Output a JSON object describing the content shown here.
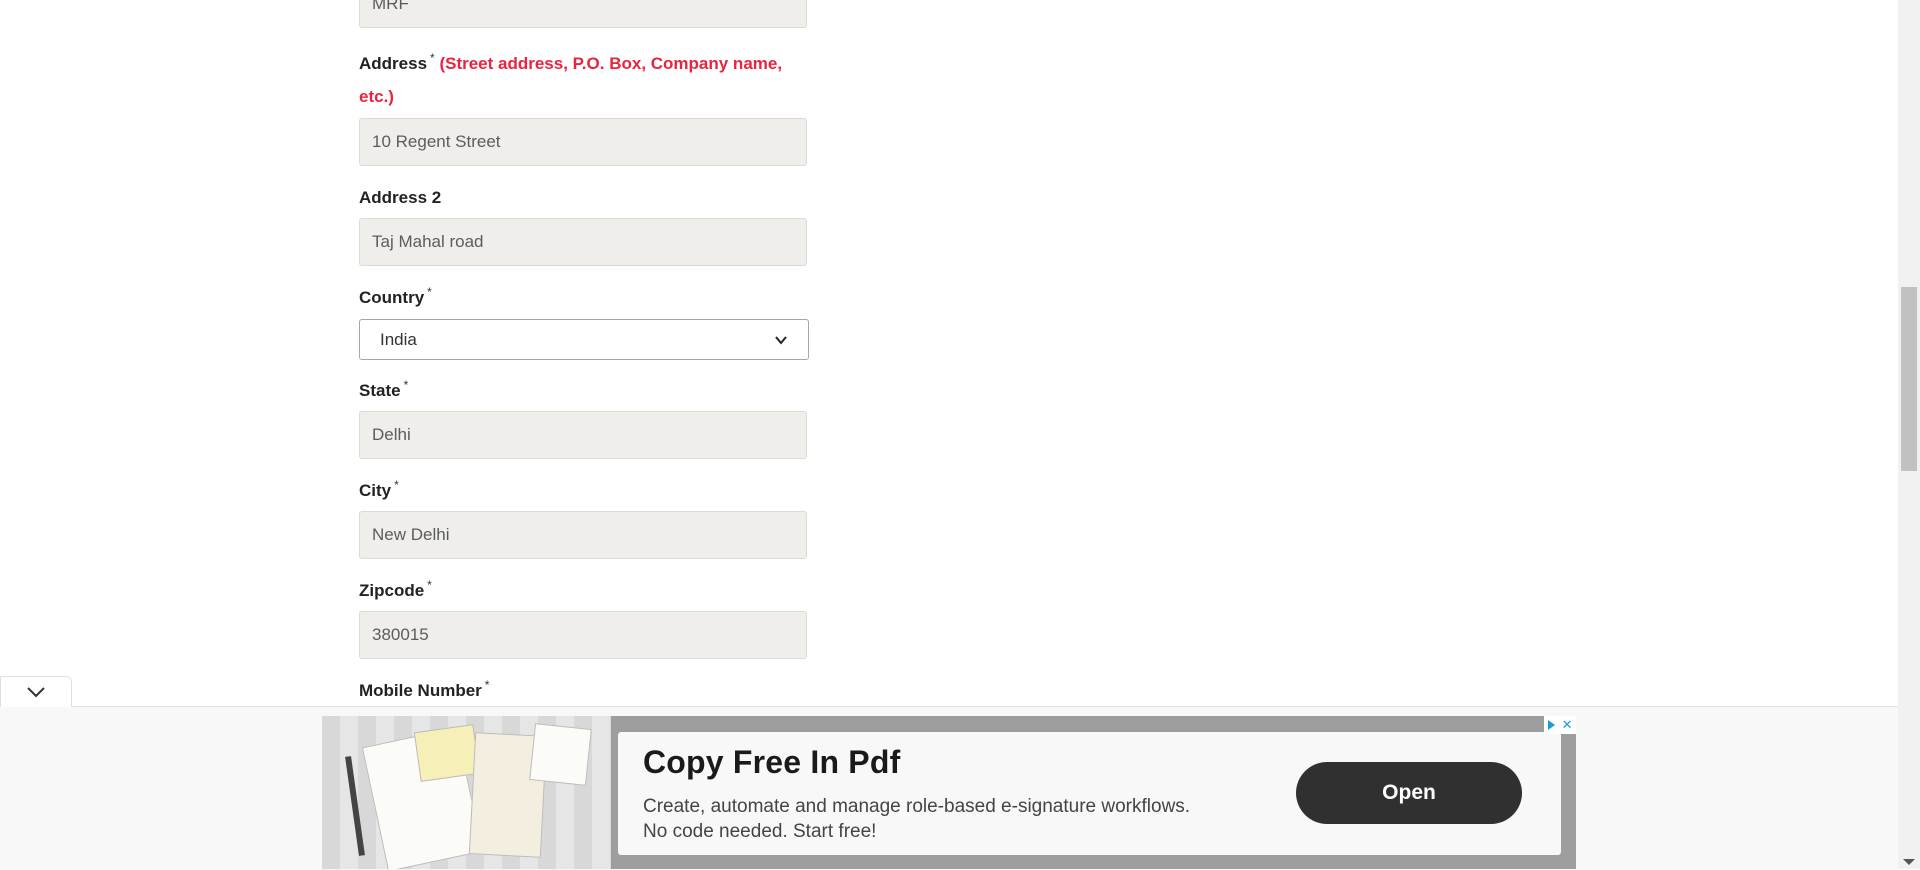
{
  "form": {
    "company": {
      "value": "MRF"
    },
    "address": {
      "label": "Address",
      "required": "*",
      "hint": "(Street address, P.O. Box, Company name, etc.)",
      "value": "10 Regent Street"
    },
    "address2": {
      "label": "Address 2",
      "value": "Taj Mahal road"
    },
    "country": {
      "label": "Country",
      "required": "*",
      "selected": "India"
    },
    "state": {
      "label": "State",
      "required": "*",
      "value": "Delhi"
    },
    "city": {
      "label": "City",
      "required": "*",
      "value": "New Delhi"
    },
    "zipcode": {
      "label": "Zipcode",
      "required": "*",
      "value": "380015"
    },
    "mobile": {
      "label": "Mobile Number",
      "required": "*"
    }
  },
  "ad": {
    "title": "Copy Free In Pdf",
    "description_line1": "Create, automate and manage role-based e-signature workflows.",
    "description_line2": "No code needed. Start free!",
    "button_label": "Open",
    "close_symbol": "✕",
    "accent_color": "#1a9bd7"
  },
  "icons": {
    "collapse": "chevron-down-icon",
    "select_arrow": "chevron-down-icon",
    "ad_choices": "adchoices-icon",
    "ad_close": "close-icon"
  },
  "colors": {
    "input_bg": "#efeeea",
    "hint_red": "#e8243f",
    "button_dark": "#303030"
  }
}
